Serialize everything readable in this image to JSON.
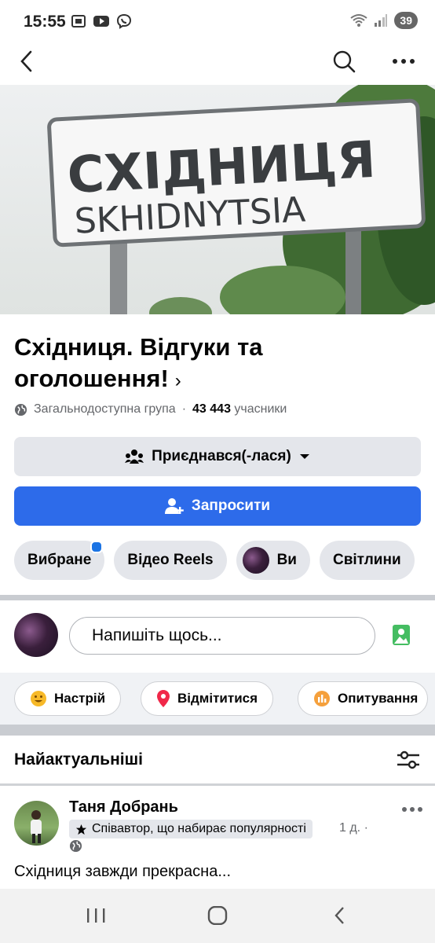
{
  "status": {
    "time": "15:55",
    "battery": "39",
    "app_icons": [
      "screenshot-icon",
      "youtube-icon",
      "viber-icon"
    ],
    "right_icons": [
      "wifi-icon",
      "signal-icon"
    ]
  },
  "appbar": {
    "icons": [
      "back-arrow-icon",
      "search-icon",
      "more-icon"
    ]
  },
  "cover": {
    "sign_line1": "СХІДНИЦЯ",
    "sign_line2": "SKHIDNYTSIA"
  },
  "group": {
    "title": "Східниця. Відгуки та оголошення!",
    "chevron": "›",
    "privacy": "Загальнодоступна група",
    "separator": "·",
    "members_count": "43 443",
    "members_label": "учасники"
  },
  "buttons": {
    "joined": "Приєднався(-лася)",
    "invite": "Запросити"
  },
  "chips": [
    {
      "label": "Вибране",
      "has_dot": true
    },
    {
      "label": "Відео Reels"
    },
    {
      "label": "Ви",
      "has_avatar": true
    },
    {
      "label": "Світлини"
    }
  ],
  "composer": {
    "placeholder": "Напишіть щось..."
  },
  "actions": [
    {
      "label": "Настрій",
      "icon": "smiley-icon",
      "color": "#f7b928"
    },
    {
      "label": "Відмітитися",
      "icon": "location-pin-icon",
      "color": "#f02849"
    },
    {
      "label": "Опитування",
      "icon": "poll-icon",
      "color": "#f5a03c"
    }
  ],
  "feed": {
    "sort_label": "Найактуальніші"
  },
  "post": {
    "author": "Таня Добрань",
    "badge": "Співавтор, що набирає популярності",
    "time": "1 д. ·",
    "text": "Східниця завжди прекрасна..."
  },
  "colors": {
    "primary": "#2d6bea",
    "chip_bg": "#e4e6eb",
    "secondary_text": "#65676b"
  }
}
